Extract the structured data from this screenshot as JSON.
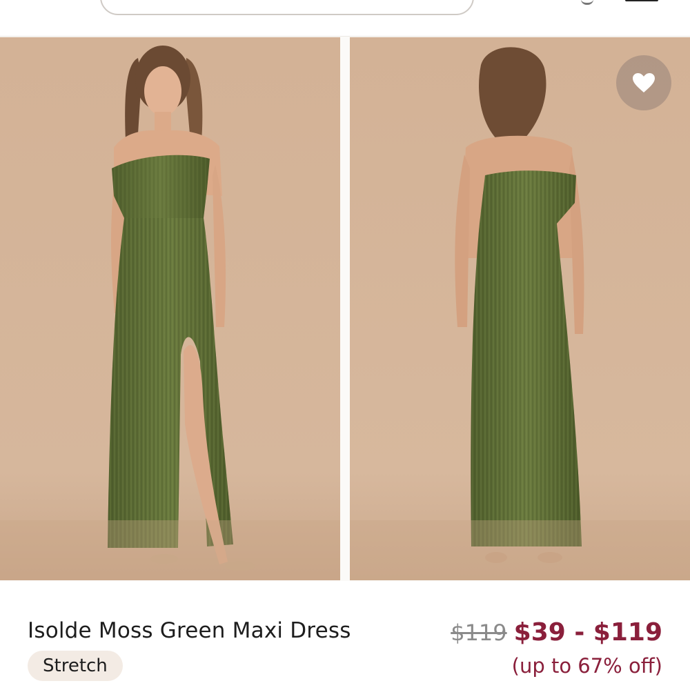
{
  "product": {
    "name": "Isolde Moss Green Maxi Dress",
    "badge": "Stretch",
    "price_original": "$119",
    "price_range": "$39 - $119",
    "discount_note": "(up to 67% off)"
  },
  "gallery": {
    "images": [
      "front-view-photo",
      "back-view-photo"
    ],
    "favorite_icon": "heart-icon"
  },
  "header": {
    "menu_icon": "hamburger-menu-icon"
  },
  "colors": {
    "price_accent": "#8a1f3b",
    "badge_bg": "#f3ebe4",
    "dress_green": "#5c6b34",
    "backdrop": "#d7b79b"
  }
}
